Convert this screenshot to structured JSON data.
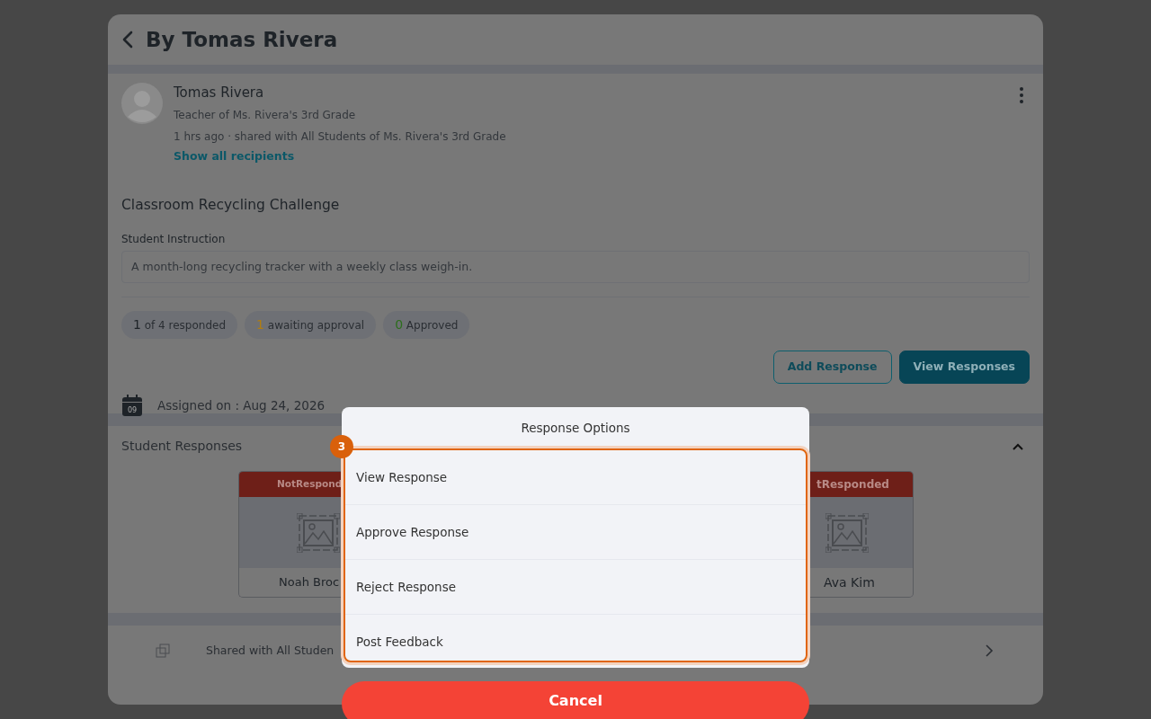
{
  "header": {
    "title": "By Tomas Rivera"
  },
  "post": {
    "author": "Tomas Rivera",
    "role": "Teacher of Ms. Rivera's 3rd Grade",
    "meta": "1 hrs ago · shared with All Students of Ms. Rivera's 3rd Grade",
    "recipients_link": "Show all recipients",
    "title": "Classroom Recycling Challenge",
    "instruction_label": "Student Instruction",
    "instruction": "A month-long recycling tracker with a weekly class weigh-in.",
    "stats": [
      {
        "count": "1",
        "label": "of 4 responded",
        "color": "#1e2328"
      },
      {
        "count": "1",
        "label": "awaiting approval",
        "color": "#b07d10"
      },
      {
        "count": "0",
        "label": "Approved",
        "color": "#2c6e1c"
      }
    ],
    "buttons": [
      {
        "label": "Add Response",
        "kind": "outline"
      },
      {
        "label": "View Responses",
        "kind": "solid"
      }
    ],
    "calendar_day": "09",
    "assigned": "Assigned on : Aug 24, 2026"
  },
  "responses": {
    "title": "Student Responses",
    "expanded": true,
    "cards": [
      {
        "status": "NotRespond",
        "name": "Noah Broc"
      },
      {
        "status": "tResponded",
        "name": "Ava Kim"
      }
    ]
  },
  "shared_row": {
    "label": "Shared with All Studen"
  },
  "sheet": {
    "title": "Response Options",
    "step": "3",
    "options": [
      "View Response",
      "Approve Response",
      "Reject Response",
      "Post Feedback"
    ],
    "cancel": "Cancel"
  }
}
